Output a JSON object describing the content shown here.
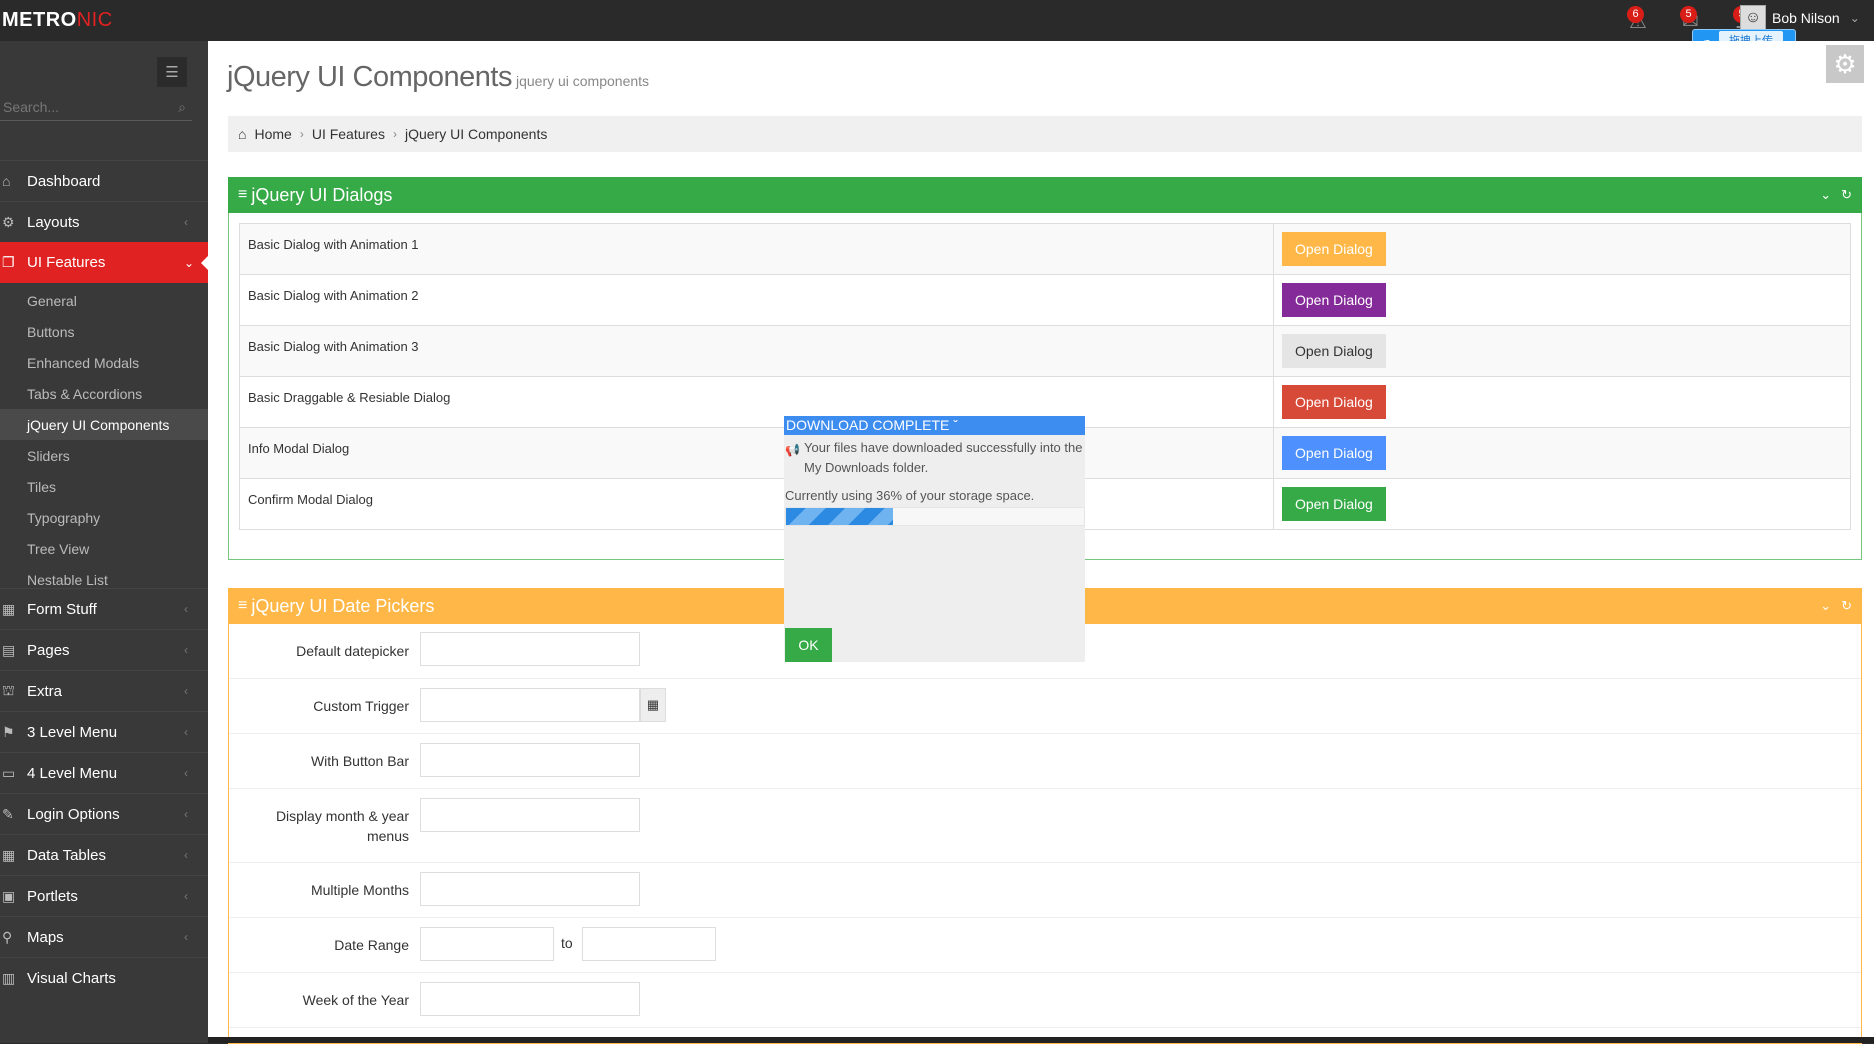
{
  "colors": {
    "brand_red": "#e02222",
    "green": "#35aa47",
    "yellow": "#ffb848",
    "purple": "#852b99",
    "red": "#d84a38",
    "blue": "#4d90fe"
  },
  "topbar": {
    "logo_main": "METRO",
    "logo_accent": "NIC",
    "notifications": [
      {
        "icon": "warning-icon",
        "glyph": "⚠",
        "count": "6"
      },
      {
        "icon": "envelope-icon",
        "glyph": "✉",
        "count": "5"
      },
      {
        "icon": "tasks-icon",
        "glyph": "☰",
        "count": "5"
      }
    ],
    "user_name": "Bob Nilson",
    "upload_label": "拖拽上传"
  },
  "sidebar": {
    "search_placeholder": "Search...",
    "items": [
      {
        "label": "Dashboard",
        "glyph": "⌂",
        "icon": "home-icon",
        "caret": ""
      },
      {
        "label": "Layouts",
        "glyph": "⚙",
        "icon": "cogs-icon",
        "caret": "‹"
      },
      {
        "label": "UI Features",
        "glyph": "❐",
        "icon": "bookmark-icon",
        "caret": "⌄"
      },
      {
        "label": "Form Stuff",
        "glyph": "▦",
        "icon": "table-icon",
        "caret": "‹"
      },
      {
        "label": "Pages",
        "glyph": "▤",
        "icon": "briefcase-icon",
        "caret": "‹"
      },
      {
        "label": "Extra",
        "glyph": "⛫",
        "icon": "gift-icon",
        "caret": "‹"
      },
      {
        "label": "3 Level Menu",
        "glyph": "⚑",
        "icon": "sitemap-icon",
        "caret": "‹"
      },
      {
        "label": "4 Level Menu",
        "glyph": "▭",
        "icon": "folder-icon",
        "caret": "‹"
      },
      {
        "label": "Login Options",
        "glyph": "✎",
        "icon": "user-icon",
        "caret": "‹"
      },
      {
        "label": "Data Tables",
        "glyph": "▦",
        "icon": "th-icon",
        "caret": "‹"
      },
      {
        "label": "Portlets",
        "glyph": "▣",
        "icon": "portlet-icon",
        "caret": "‹"
      },
      {
        "label": "Maps",
        "glyph": "⚲",
        "icon": "map-marker-icon",
        "caret": "‹"
      },
      {
        "label": "Visual Charts",
        "glyph": "▥",
        "icon": "bar-chart-icon",
        "caret": ""
      }
    ],
    "sub_items": [
      "General",
      "Buttons",
      "Enhanced Modals",
      "Tabs & Accordions",
      "jQuery UI Components",
      "Sliders",
      "Tiles",
      "Typography",
      "Tree View",
      "Nestable List"
    ]
  },
  "page": {
    "title": "jQuery UI Components",
    "subtitle": "jquery ui components",
    "breadcrumb": [
      "Home",
      "UI Features",
      "jQuery UI Components"
    ]
  },
  "dialogs_portlet": {
    "title": "jQuery UI Dialogs",
    "rows": [
      {
        "label": "Basic Dialog with Animation 1",
        "button": "Open Dialog",
        "bg": "#ffb848",
        "fg": "#ffffff"
      },
      {
        "label": "Basic Dialog with Animation 2",
        "button": "Open Dialog",
        "bg": "#852b99",
        "fg": "#ffffff"
      },
      {
        "label": "Basic Dialog with Animation 3",
        "button": "Open Dialog",
        "bg": "#e5e5e5",
        "fg": "#333333"
      },
      {
        "label": "Basic Draggable & Resiable Dialog",
        "button": "Open Dialog",
        "bg": "#d84a38",
        "fg": "#ffffff"
      },
      {
        "label": "Info Modal Dialog",
        "button": "Open Dialog",
        "bg": "#4d90fe",
        "fg": "#ffffff"
      },
      {
        "label": "Confirm Modal Dialog",
        "button": "Open Dialog",
        "bg": "#35aa47",
        "fg": "#ffffff"
      }
    ]
  },
  "pickers_portlet": {
    "title": "jQuery UI Date Pickers",
    "rows": {
      "default_label": "Default datepicker",
      "custom_label": "Custom Trigger",
      "buttonbar_label": "With Button Bar",
      "monthyear_label": "Display month & year menus",
      "multiple_label": "Multiple Months",
      "range_label": "Date Range",
      "range_to": "to",
      "week_label": "Week of the Year"
    }
  },
  "download_dialog": {
    "title": "DOWNLOAD COMPLETE ˇ",
    "message": "Your files have downloaded successfully into the My Downloads folder.",
    "usage": "Currently using 36% of your storage space.",
    "progress_fraction": 0.36,
    "ok_label": "OK"
  }
}
